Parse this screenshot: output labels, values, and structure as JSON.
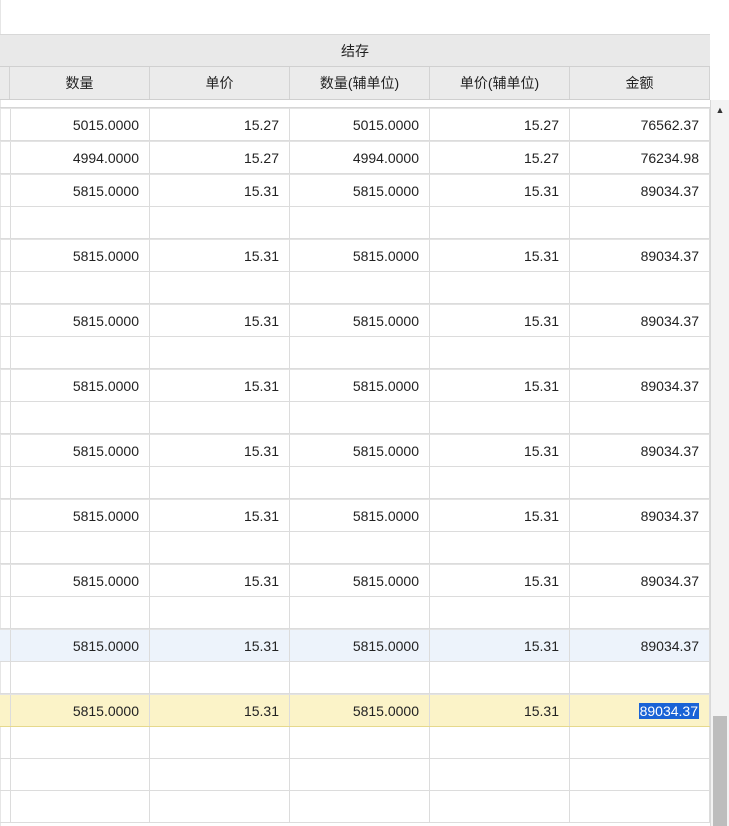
{
  "group_header": {
    "label": "结存"
  },
  "columns": [
    {
      "label": "数量"
    },
    {
      "label": "单价"
    },
    {
      "label": "数量(辅单位)"
    },
    {
      "label": "单价(辅单位)"
    },
    {
      "label": "金额"
    }
  ],
  "rows": [
    {
      "kind": "sep"
    },
    {
      "kind": "data",
      "values": [
        "5015.0000",
        "15.27",
        "5015.0000",
        "15.27",
        "76562.37"
      ]
    },
    {
      "kind": "data",
      "values": [
        "4994.0000",
        "15.27",
        "4994.0000",
        "15.27",
        "76234.98"
      ]
    },
    {
      "kind": "data",
      "values": [
        "5815.0000",
        "15.31",
        "5815.0000",
        "15.31",
        "89034.37"
      ]
    },
    {
      "kind": "blank"
    },
    {
      "kind": "data",
      "values": [
        "5815.0000",
        "15.31",
        "5815.0000",
        "15.31",
        "89034.37"
      ]
    },
    {
      "kind": "blank"
    },
    {
      "kind": "data",
      "values": [
        "5815.0000",
        "15.31",
        "5815.0000",
        "15.31",
        "89034.37"
      ]
    },
    {
      "kind": "blank"
    },
    {
      "kind": "data",
      "values": [
        "5815.0000",
        "15.31",
        "5815.0000",
        "15.31",
        "89034.37"
      ]
    },
    {
      "kind": "blank"
    },
    {
      "kind": "data",
      "values": [
        "5815.0000",
        "15.31",
        "5815.0000",
        "15.31",
        "89034.37"
      ]
    },
    {
      "kind": "blank"
    },
    {
      "kind": "data",
      "values": [
        "5815.0000",
        "15.31",
        "5815.0000",
        "15.31",
        "89034.37"
      ]
    },
    {
      "kind": "blank"
    },
    {
      "kind": "data",
      "values": [
        "5815.0000",
        "15.31",
        "5815.0000",
        "15.31",
        "89034.37"
      ]
    },
    {
      "kind": "blank"
    },
    {
      "kind": "data",
      "state": "hover",
      "values": [
        "5815.0000",
        "15.31",
        "5815.0000",
        "15.31",
        "89034.37"
      ]
    },
    {
      "kind": "blank"
    },
    {
      "kind": "data",
      "state": "selected",
      "selected_col": 4,
      "values": [
        "5815.0000",
        "15.31",
        "5815.0000",
        "15.31",
        "89034.37"
      ]
    },
    {
      "kind": "blank"
    },
    {
      "kind": "blank"
    },
    {
      "kind": "blank"
    }
  ],
  "colors": {
    "header_bg": "#e9e9e9",
    "hover_row_bg": "#edf3fb",
    "selected_row_bg": "#fbf3c8",
    "text_selection_bg": "#1a63d6"
  },
  "scrollbar": {
    "up_arrow_icon": "triangle-up-icon"
  }
}
